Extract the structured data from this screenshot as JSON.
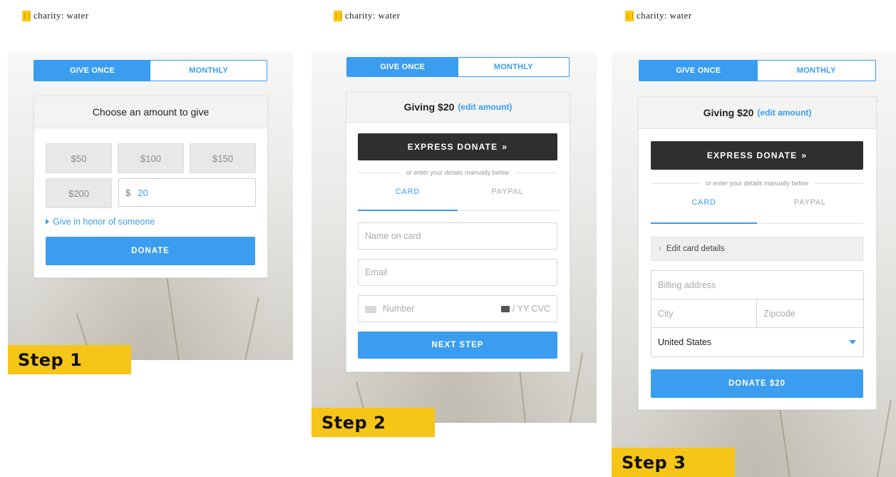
{
  "brand": {
    "name": "charity: water",
    "icon": "jerrycan-icon",
    "accent": "#3a9df0",
    "step_color": "#f5c518"
  },
  "tabs": {
    "give_once": "GIVE ONCE",
    "monthly": "MONTHLY"
  },
  "step1": {
    "label": "Step 1",
    "heading": "Choose an amount to give",
    "amounts": [
      "$50",
      "$100",
      "$150",
      "$200"
    ],
    "custom_currency": "$",
    "custom_value": "20",
    "honor_link": "Give in honor of someone",
    "donate_button": "DONATE"
  },
  "step2": {
    "label": "Step 2",
    "heading_prefix": "Giving $20",
    "edit_amount": "(edit amount)",
    "express_button": "EXPRESS DONATE",
    "express_icon": "double-chevron-right-icon",
    "divider": "or enter your details manually below",
    "pay_tabs": {
      "card": "CARD",
      "paypal": "PAYPAL"
    },
    "name_placeholder": "Name on card",
    "email_placeholder": "Email",
    "number_placeholder": "Number",
    "expiry_cvc_placeholder": "/ YY  CVC",
    "next_button": "NEXT STEP"
  },
  "step3": {
    "label": "Step 3",
    "heading_prefix": "Giving $20",
    "edit_amount": "(edit amount)",
    "express_button": "EXPRESS DONATE",
    "divider": "or enter your details manually below",
    "pay_tabs": {
      "card": "CARD",
      "paypal": "PAYPAL"
    },
    "edit_card": "Edit card details",
    "billing_placeholder": "Billing address",
    "city_placeholder": "City",
    "zip_placeholder": "Zipcode",
    "country": "United States",
    "donate_button": "DONATE $20"
  }
}
